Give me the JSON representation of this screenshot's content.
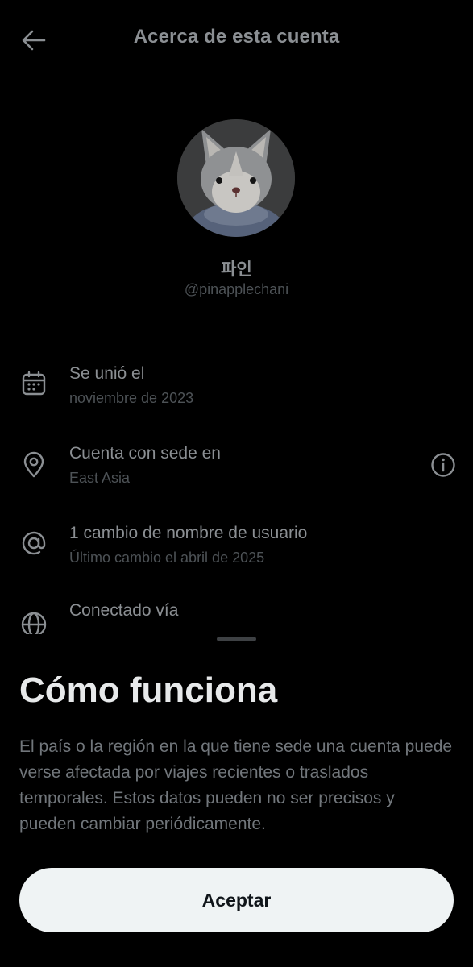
{
  "header": {
    "title": "Acerca de esta cuenta",
    "back_icon": "arrow-left-icon"
  },
  "profile": {
    "display_name": "파인",
    "handle": "@pinapplechani"
  },
  "info": {
    "joined": {
      "icon": "calendar-icon",
      "title": "Se unió el",
      "value": "noviembre de 2023"
    },
    "location": {
      "icon": "location-pin-icon",
      "title": "Cuenta con sede en",
      "value": "East Asia",
      "info_icon": "info-icon"
    },
    "username": {
      "icon": "at-sign-icon",
      "title": "1 cambio de nombre de usuario",
      "value": "Último cambio el abril de 2025"
    },
    "connected": {
      "icon": "globe-icon",
      "title": "Conectado vía"
    }
  },
  "sheet": {
    "title": "Cómo funciona",
    "body": "El país o la región en la que tiene sede una cuenta puede verse afectada por viajes recientes o traslados temporales. Estos datos pueden no ser precisos y pueden cambiar periódicamente.",
    "accept_label": "Aceptar"
  },
  "colors": {
    "background": "#000000",
    "dimmed_text": "#8b8f93",
    "secondary_text": "#4d5256",
    "sheet_text": "#71767b",
    "button_bg": "#eff3f4",
    "button_text": "#0f1419"
  }
}
